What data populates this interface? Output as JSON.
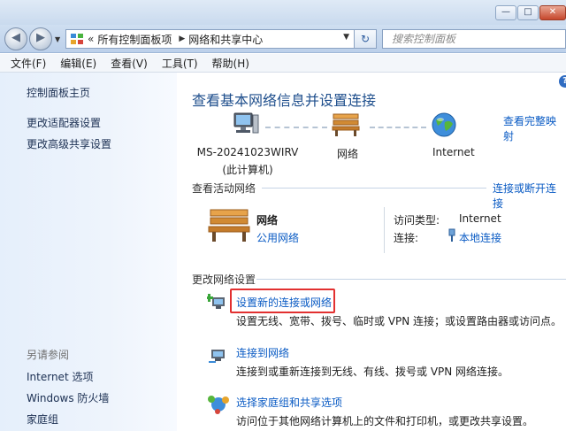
{
  "window": {
    "minimize": "—",
    "maximize": "□",
    "close": "✕"
  },
  "nav": {
    "back": "◀",
    "forward": "▶",
    "address": {
      "chevron": "«",
      "crumbs": [
        "所有控制面板项",
        "网络和共享中心"
      ],
      "separator": "▶"
    },
    "search_placeholder": "搜索控制面板"
  },
  "menu": [
    "文件(F)",
    "编辑(E)",
    "查看(V)",
    "工具(T)",
    "帮助(H)"
  ],
  "sidebar": {
    "links": [
      "控制面板主页",
      "更改适配器设置",
      "更改高级共享设置"
    ],
    "see_also_title": "另请参阅",
    "see_also": [
      "Internet 选项",
      "Windows 防火墙",
      "家庭组"
    ]
  },
  "main": {
    "title": "查看基本网络信息并设置连接",
    "view_full_map": "查看完整映射",
    "map": {
      "computer_name": "MS-20241023WIRV",
      "computer_sub": "(此计算机)",
      "network": "网络",
      "internet": "Internet"
    },
    "active_networks": {
      "header": "查看活动网络",
      "connect_disconnect": "连接或断开连接",
      "name": "网络",
      "type": "公用网络",
      "access_label": "访问类型:",
      "access_value": "Internet",
      "connection_label": "连接:",
      "connection_value": "本地连接"
    },
    "change_settings": {
      "header": "更改网络设置",
      "items": [
        {
          "title": "设置新的连接或网络",
          "desc": "设置无线、宽带、拨号、临时或 VPN 连接；或设置路由器或访问点。"
        },
        {
          "title": "连接到网络",
          "desc": "连接到或重新连接到无线、有线、拨号或 VPN 网络连接。"
        },
        {
          "title": "选择家庭组和共享选项",
          "desc": "访问位于其他网络计算机上的文件和打印机，或更改共享设置。"
        }
      ]
    }
  },
  "colors": {
    "link": "#0a5bc4",
    "title": "#1e4e8c",
    "highlight_box": "#e23030"
  }
}
